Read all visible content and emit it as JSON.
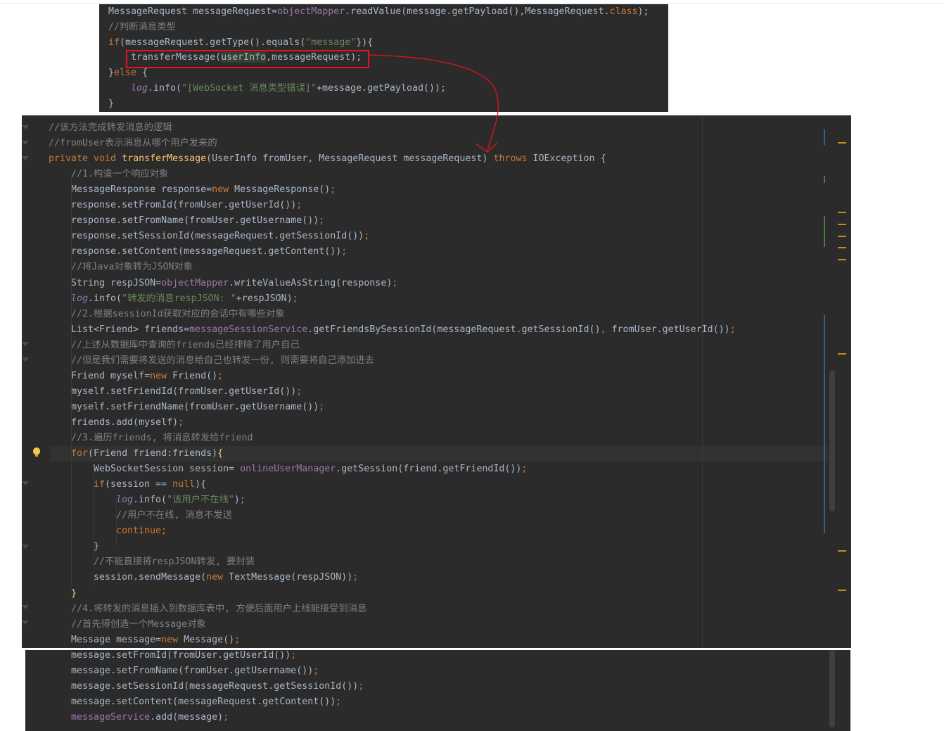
{
  "snippet_top": {
    "lines": [
      {
        "indent": 0,
        "tokens": [
          [
            "txt",
            "MessageRequest messageRequest="
          ],
          [
            "fld",
            "objectMapper"
          ],
          [
            "txt",
            ".readValue(message.getPayload(),MessageRequest."
          ],
          [
            "kw",
            "class"
          ],
          [
            "txt",
            ");"
          ]
        ]
      },
      {
        "indent": 0,
        "tokens": [
          [
            "cmt",
            "//判断消息类型"
          ]
        ]
      },
      {
        "indent": 0,
        "tokens": [
          [
            "kw",
            "if"
          ],
          [
            "txt",
            "(messageRequest.getType().equals("
          ],
          [
            "str",
            "\"message\""
          ],
          [
            "txt",
            "}){"
          ]
        ]
      },
      {
        "indent": 1,
        "tokens": [
          [
            "txt",
            "transferMessage("
          ],
          [
            "hl",
            "userInfo"
          ],
          [
            "txt",
            ",messageRequest);"
          ]
        ]
      },
      {
        "indent": 0,
        "tokens": [
          [
            "txt",
            "}"
          ],
          [
            "kw",
            "else"
          ],
          [
            "txt",
            " {"
          ]
        ]
      },
      {
        "indent": 1,
        "tokens": [
          [
            "itl",
            "log"
          ],
          [
            "txt",
            ".info("
          ],
          [
            "str",
            "\"[WebSocket 消息类型错误]\""
          ],
          [
            "txt",
            "+message.getPayload());"
          ]
        ]
      },
      {
        "indent": 0,
        "tokens": [
          [
            "txt",
            "}"
          ]
        ]
      }
    ]
  },
  "main_editor": {
    "lines": [
      {
        "indent": 0,
        "tokens": [
          [
            "cmt",
            "//该方法完成转发消息的逻辑"
          ]
        ]
      },
      {
        "indent": 0,
        "tokens": [
          [
            "cmt",
            "//fromUser表示消息从哪个用户发来的"
          ]
        ]
      },
      {
        "indent": 0,
        "tokens": [
          [
            "kw",
            "private void "
          ],
          [
            "fn",
            "transferMessage"
          ],
          [
            "txt",
            "(UserInfo fromUser, MessageRequest messageRequest) "
          ],
          [
            "kw",
            "throws "
          ],
          [
            "txt",
            "IOException {"
          ]
        ]
      },
      {
        "indent": 1,
        "tokens": [
          [
            "cmt",
            "//1.构造一个响应对象"
          ]
        ]
      },
      {
        "indent": 1,
        "tokens": [
          [
            "txt",
            "MessageResponse response="
          ],
          [
            "kw",
            "new "
          ],
          [
            "txt",
            "MessageResponse()"
          ],
          [
            "kw",
            ";"
          ]
        ]
      },
      {
        "indent": 1,
        "tokens": [
          [
            "txt",
            "response.setFromId(fromUser.getUserId())"
          ],
          [
            "kw",
            ";"
          ]
        ]
      },
      {
        "indent": 1,
        "tokens": [
          [
            "txt",
            "response.setFromName(fromUser.getUsername())"
          ],
          [
            "kw",
            ";"
          ]
        ]
      },
      {
        "indent": 1,
        "tokens": [
          [
            "txt",
            "response.setSessionId(messageRequest.getSessionId())"
          ],
          [
            "kw",
            ";"
          ]
        ]
      },
      {
        "indent": 1,
        "tokens": [
          [
            "txt",
            "response.setContent(messageRequest.getContent())"
          ],
          [
            "kw",
            ";"
          ]
        ]
      },
      {
        "indent": 1,
        "tokens": [
          [
            "cmt",
            "//将Java对象转为JSON对象"
          ]
        ]
      },
      {
        "indent": 1,
        "tokens": [
          [
            "txt",
            "String respJSON="
          ],
          [
            "fld",
            "objectMapper"
          ],
          [
            "txt",
            ".writeValueAsString(response)"
          ],
          [
            "kw",
            ";"
          ]
        ]
      },
      {
        "indent": 1,
        "tokens": [
          [
            "itl",
            "log"
          ],
          [
            "txt",
            ".info("
          ],
          [
            "str",
            "\"转发的消息respJSON: \""
          ],
          [
            "txt",
            "+respJSON)"
          ],
          [
            "kw",
            ";"
          ]
        ]
      },
      {
        "indent": 1,
        "tokens": [
          [
            "cmt",
            "//2.根据sessionId获取对应的会话中有哪些对象"
          ]
        ]
      },
      {
        "indent": 1,
        "tokens": [
          [
            "txt",
            "List<Friend> friends="
          ],
          [
            "fld",
            "messageSessionService"
          ],
          [
            "txt",
            ".getFriendsBySessionId(messageRequest.getSessionId()"
          ],
          [
            "kw",
            ", "
          ],
          [
            "txt",
            "fromUser.getUserId())"
          ],
          [
            "kw",
            ";"
          ]
        ]
      },
      {
        "indent": 1,
        "tokens": [
          [
            "cmt",
            "//上述从数据库中查询的friends已经排除了用户自己"
          ]
        ]
      },
      {
        "indent": 1,
        "tokens": [
          [
            "cmt",
            "//但是我们需要将发送的消息给自己也转发一份, 则需要将自己添加进去"
          ]
        ]
      },
      {
        "indent": 1,
        "tokens": [
          [
            "txt",
            "Friend myself="
          ],
          [
            "kw",
            "new "
          ],
          [
            "txt",
            "Friend()"
          ],
          [
            "kw",
            ";"
          ]
        ]
      },
      {
        "indent": 1,
        "tokens": [
          [
            "txt",
            "myself.setFriendId(fromUser.getUserId())"
          ],
          [
            "kw",
            ";"
          ]
        ]
      },
      {
        "indent": 1,
        "tokens": [
          [
            "txt",
            "myself.setFriendName(fromUser.getUsername())"
          ],
          [
            "kw",
            ";"
          ]
        ]
      },
      {
        "indent": 1,
        "tokens": [
          [
            "txt",
            "friends.add(myself)"
          ],
          [
            "kw",
            ";"
          ]
        ]
      },
      {
        "indent": 1,
        "tokens": [
          [
            "cmt",
            "//3.遍历friends, 将消息转发给friend"
          ]
        ]
      },
      {
        "indent": 1,
        "tokens": [
          [
            "kw",
            "for"
          ],
          [
            "txt",
            "(Friend friend:friends)"
          ],
          [
            "fn",
            "{"
          ]
        ]
      },
      {
        "indent": 2,
        "tokens": [
          [
            "txt",
            "WebSocketSession session= "
          ],
          [
            "fld",
            "onlineUserManager"
          ],
          [
            "txt",
            ".getSession(friend.getFriendId())"
          ],
          [
            "kw",
            ";"
          ]
        ]
      },
      {
        "indent": 2,
        "tokens": [
          [
            "kw",
            "if"
          ],
          [
            "txt",
            "(session == "
          ],
          [
            "kw",
            "null"
          ],
          [
            "txt",
            "){"
          ]
        ]
      },
      {
        "indent": 3,
        "tokens": [
          [
            "itl",
            "log"
          ],
          [
            "txt",
            ".info("
          ],
          [
            "str",
            "\"该用户不在线\""
          ],
          [
            "txt",
            ")"
          ],
          [
            "kw",
            ";"
          ]
        ]
      },
      {
        "indent": 3,
        "tokens": [
          [
            "cmt",
            "//用户不在线, 消息不发送"
          ]
        ]
      },
      {
        "indent": 3,
        "tokens": [
          [
            "kw",
            "continue;"
          ]
        ]
      },
      {
        "indent": 2,
        "tokens": [
          [
            "txt",
            "}"
          ]
        ]
      },
      {
        "indent": 2,
        "tokens": [
          [
            "cmt",
            "//不能直接将respJSON转发, 要封装"
          ]
        ]
      },
      {
        "indent": 2,
        "tokens": [
          [
            "txt",
            "session.sendMessage("
          ],
          [
            "kw",
            "new "
          ],
          [
            "txt",
            "TextMessage(respJSON))"
          ],
          [
            "kw",
            ";"
          ]
        ]
      },
      {
        "indent": 1,
        "tokens": [
          [
            "fn",
            "}"
          ]
        ]
      },
      {
        "indent": 1,
        "tokens": [
          [
            "cmt",
            "//4.将转发的消息插入到数据库表中, 方便后面用户上线能接受到消息"
          ]
        ]
      },
      {
        "indent": 1,
        "tokens": [
          [
            "cmt",
            "//首先得创造一个Message对象"
          ]
        ]
      },
      {
        "indent": 1,
        "tokens": [
          [
            "txt",
            "Message message="
          ],
          [
            "kw",
            "new "
          ],
          [
            "txt",
            "Message()"
          ],
          [
            "kw",
            ";"
          ]
        ]
      }
    ]
  },
  "snippet_bottom": {
    "lines": [
      {
        "indent": 1,
        "tokens": [
          [
            "txt",
            "message.setFromId(fromUser.getUserId())"
          ],
          [
            "kw",
            ";"
          ]
        ]
      },
      {
        "indent": 1,
        "tokens": [
          [
            "txt",
            "message.setFromName(fromUser.getUsername())"
          ],
          [
            "kw",
            ";"
          ]
        ]
      },
      {
        "indent": 1,
        "tokens": [
          [
            "txt",
            "message.setSessionId(messageRequest.getSessionId())"
          ],
          [
            "kw",
            ";"
          ]
        ]
      },
      {
        "indent": 1,
        "tokens": [
          [
            "txt",
            "message.setContent(messageRequest.getContent())"
          ],
          [
            "kw",
            ";"
          ]
        ]
      },
      {
        "indent": 1,
        "tokens": [
          [
            "fld",
            "messageService"
          ],
          [
            "txt",
            ".add(message)"
          ],
          [
            "kw",
            ";"
          ]
        ]
      }
    ]
  },
  "annotations": {
    "highlighted_call": "transferMessage(userInfo,messageRequest);",
    "arrow_color": "#e5141c"
  },
  "colors": {
    "background": "#2b2b2b",
    "keyword": "#cc7832",
    "field": "#9876aa",
    "string": "#6a8759",
    "comment": "#808080",
    "method_decl": "#ffc66d",
    "text": "#a9b7c6"
  }
}
